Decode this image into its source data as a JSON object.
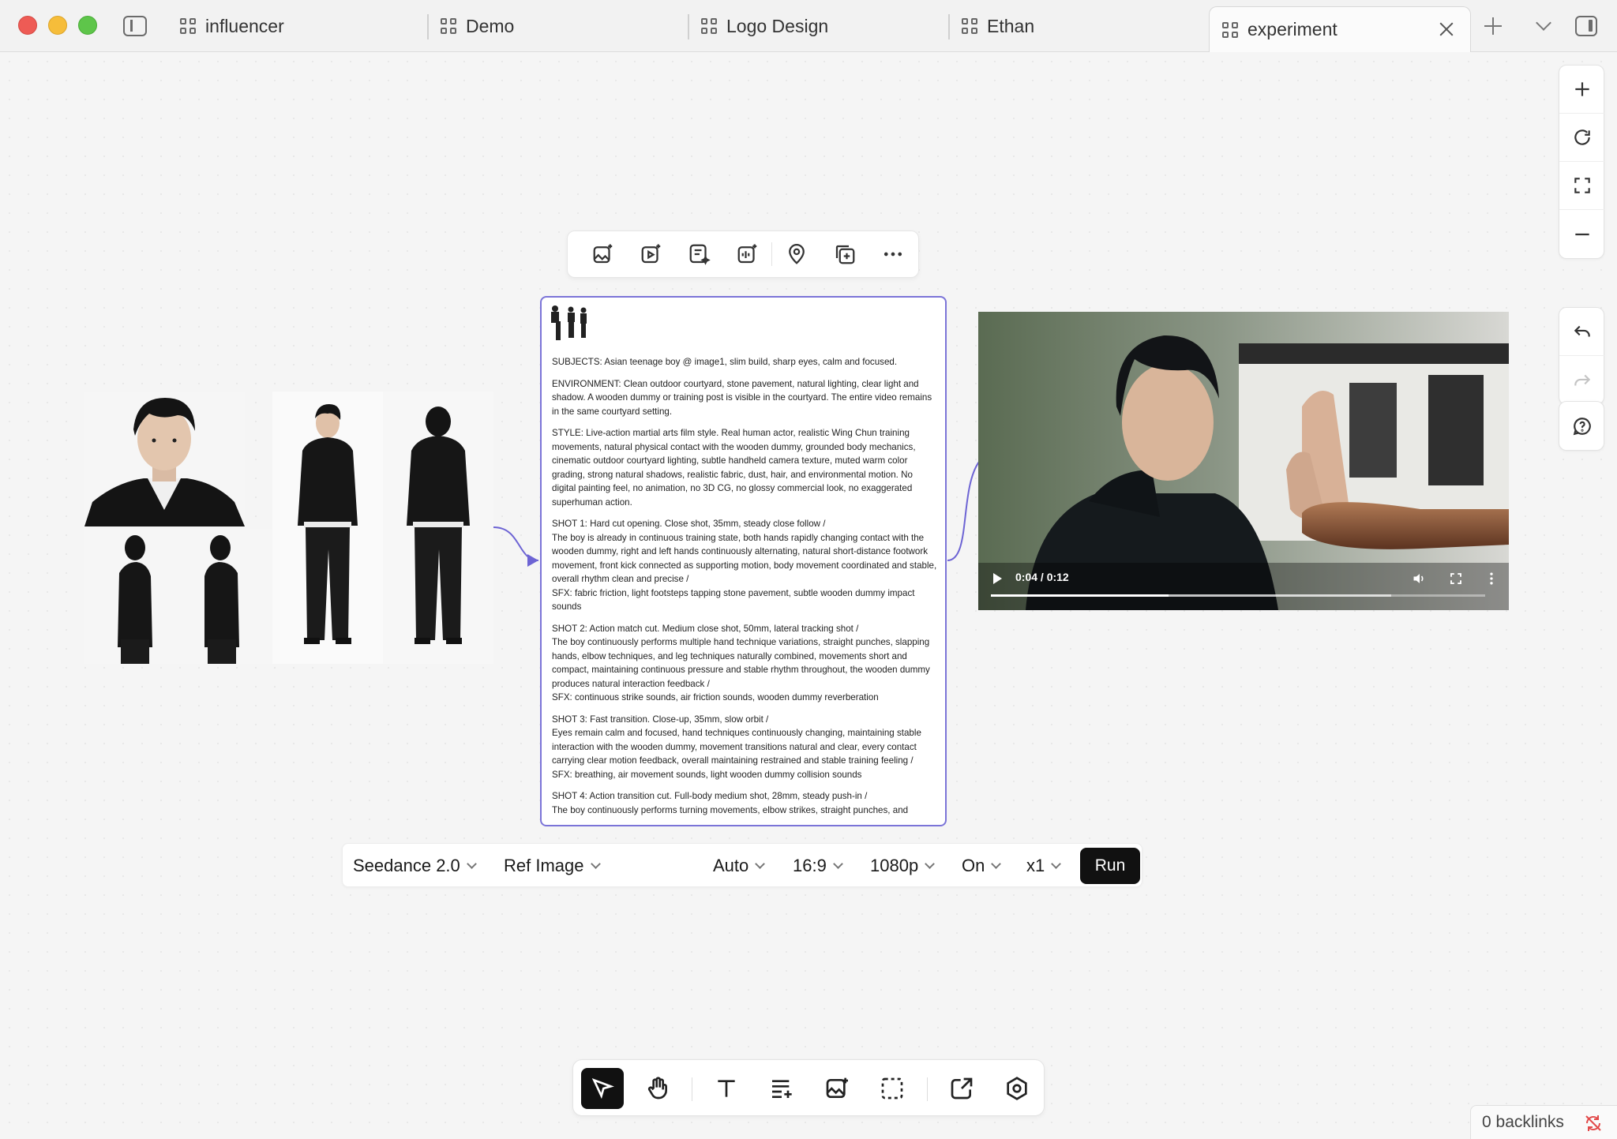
{
  "window": {
    "tabs": [
      {
        "label": "influencer",
        "active": false
      },
      {
        "label": "Demo",
        "active": false
      },
      {
        "label": "Logo Design",
        "active": false
      },
      {
        "label": "Ethan",
        "active": false
      },
      {
        "label": "experiment",
        "active": true
      }
    ]
  },
  "right_rail": {
    "icons": [
      "zoom-in-icon",
      "refresh-icon",
      "fit-screen-icon",
      "zoom-out-icon",
      "undo-icon",
      "redo-icon",
      "help-icon"
    ]
  },
  "node_toolbar": {
    "icons": [
      "image-generate-icon",
      "video-generate-icon",
      "text-generate-icon",
      "audio-generate-icon",
      "location-pin-icon",
      "duplicate-icon",
      "more-icon"
    ]
  },
  "prompt": {
    "paragraphs": [
      "SUBJECTS: Asian teenage boy @ image1, slim build, sharp eyes, calm and focused.",
      "ENVIRONMENT: Clean outdoor courtyard, stone pavement, natural lighting, clear light and shadow. A wooden dummy or training post is visible in the courtyard. The entire video remains in the same courtyard setting.",
      "STYLE: Live-action martial arts film style. Real human actor, realistic Wing Chun training movements, natural physical contact with the wooden dummy, grounded body mechanics, cinematic outdoor courtyard lighting, subtle handheld camera texture, muted warm color grading, strong natural shadows, realistic fabric, dust, hair, and environmental motion. No digital painting feel, no animation, no 3D CG, no glossy commercial look, no exaggerated superhuman action.",
      "SHOT 1: Hard cut opening. Close shot, 35mm, steady close follow /\nThe boy is already in continuous training state, both hands rapidly changing contact with the wooden dummy, right and left hands continuously alternating, natural short-distance footwork movement, front kick connected as supporting motion, body movement coordinated and stable, overall rhythm clean and precise /\nSFX: fabric friction, light footsteps tapping stone pavement, subtle wooden dummy impact sounds",
      "SHOT 2: Action match cut. Medium close shot, 50mm, lateral tracking shot /\nThe boy continuously performs multiple hand technique variations, straight punches, slapping hands, elbow techniques, and leg techniques naturally combined, movements short and compact, maintaining continuous pressure and stable rhythm throughout, the wooden dummy produces natural interaction feedback /\nSFX: continuous strike sounds, air friction sounds, wooden dummy reverberation",
      "SHOT 3: Fast transition. Close-up, 35mm, slow orbit /\nEyes remain calm and focused, hand techniques continuously changing, maintaining stable interaction with the wooden dummy, movement transitions natural and clear, every contact carrying clear motion feedback, overall maintaining restrained and stable training feeling /\nSFX: breathing, air movement sounds, light wooden dummy collision sounds",
      "SHOT 4: Action transition cut. Full-body medium shot, 28mm, steady push-in /\nThe boy continuously performs turning movements, elbow strikes, straight punches, and"
    ]
  },
  "video": {
    "time": "0:04 / 0:12",
    "progress": 0.36,
    "buffered": 0.81,
    "icons": [
      "play-icon",
      "volume-icon",
      "fullscreen-icon",
      "more-vertical-icon"
    ]
  },
  "generation_bar": {
    "model": "Seedance 2.0",
    "mode": "Ref Image",
    "duration": "Auto",
    "ratio": "16:9",
    "resolution": "1080p",
    "audio": "On",
    "count": "x1",
    "run_label": "Run"
  },
  "dock": {
    "icons": [
      "select-cursor-icon",
      "hand-pan-icon",
      "text-tool-icon",
      "list-add-icon",
      "image-add-icon",
      "frame-select-icon",
      "export-icon",
      "settings-hex-icon"
    ],
    "active": "select-cursor-icon"
  },
  "footer": {
    "backlinks": "0 backlinks"
  },
  "colors": {
    "accent": "#7b74d8",
    "run_button": "#111111",
    "backlink_icon": "#e24a4a"
  }
}
